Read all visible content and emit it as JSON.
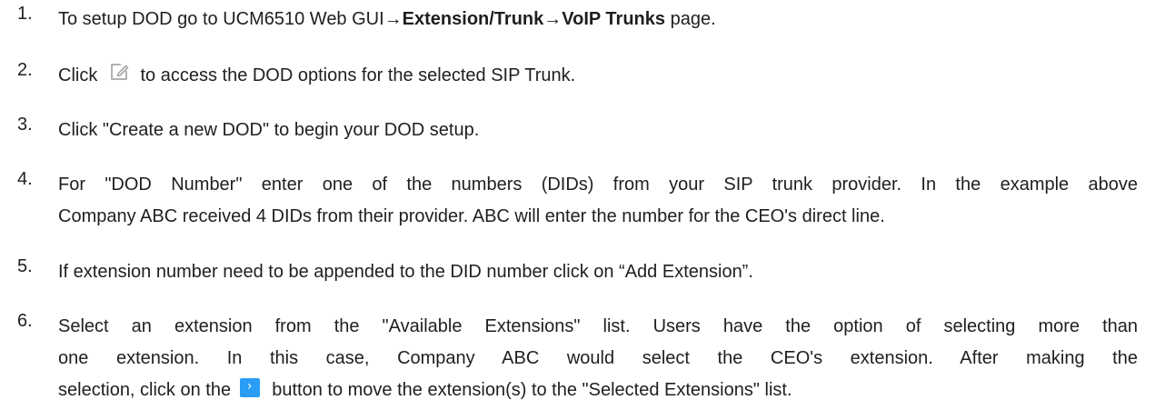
{
  "steps": [
    {
      "number": "1.",
      "pre": "To setup DOD go to UCM6510 Web GUI",
      "arrow1": "→",
      "bold1": "Extension/Trunk",
      "arrow2": "→",
      "bold2": "VoIP Trunks",
      "post": " page."
    },
    {
      "number": "2.",
      "pre": "Click",
      "icon": "edit-icon",
      "post": "to access the DOD options for the selected SIP Trunk."
    },
    {
      "number": "3.",
      "text": "Click \"Create a new DOD\" to begin your DOD setup."
    },
    {
      "number": "4.",
      "line1": "For \"DOD Number\" enter one of the numbers (DIDs) from your SIP trunk provider. In the example above",
      "line2": "Company ABC received 4 DIDs from their provider. ABC will enter the number for the CEO's direct line."
    },
    {
      "number": "5.",
      "text": "If extension number need to be appended to the DID number click on “Add Extension”."
    },
    {
      "number": "6.",
      "line1": "Select an extension from the \"Available Extensions\" list. Users have the option of selecting more than",
      "line2": "one extension. In this case, Company ABC would select the CEO's extension. After making the",
      "line3_pre": "selection, click on the",
      "button_glyph": "›",
      "line3_post": "button to move the extension(s) to the \"Selected Extensions\" list."
    }
  ],
  "colors": {
    "text": "#1f1f1f",
    "button_blue": "#2a9df4",
    "icon_gray": "#a8a8a8"
  }
}
